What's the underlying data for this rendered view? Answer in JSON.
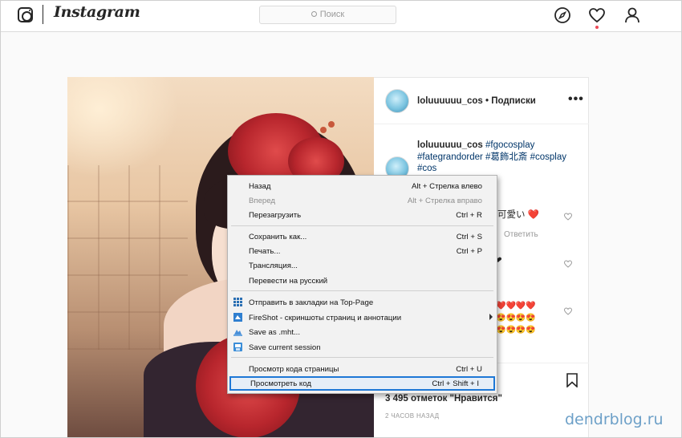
{
  "header": {
    "brand": "Instagram",
    "search_placeholder": "Поиск"
  },
  "post": {
    "username": "loluuuuuu_cos",
    "follow_label": "Подписки",
    "header_line": "loluuuuuu_cos • Подписки",
    "more_label": "•••",
    "caption": {
      "username": "loluuuuuu_cos",
      "tags_line1": "#fgocosplay",
      "tags_line2": "#fategrandorder #葛飾北斎 #cosplay",
      "tags_line3": "#cos"
    },
    "comment_fragments": {
      "c1": "可愛い ❤️",
      "reply": "Ответить",
      "c2": "❤",
      "c3_line1": "❤️❤️❤️❤️",
      "c3_line2": "😍😍😍😍",
      "c3_line3": "😍😍😍😍"
    },
    "likes_text": "3 495 отметок \"Нравится\"",
    "time_text": "2 ЧАСОВ НАЗАД"
  },
  "context_menu": {
    "items": [
      {
        "label": "Назад",
        "shortcut": "Alt + Стрелка влево",
        "disabled": false
      },
      {
        "label": "Вперед",
        "shortcut": "Alt + Стрелка вправо",
        "disabled": true
      },
      {
        "label": "Перезагрузить",
        "shortcut": "Ctrl + R",
        "disabled": false
      },
      {
        "label": "Сохранить как...",
        "shortcut": "Ctrl + S"
      },
      {
        "label": "Печать...",
        "shortcut": "Ctrl + P"
      },
      {
        "label": "Трансляция..."
      },
      {
        "label": "Перевести на русский"
      },
      {
        "label": "Отправить в закладки на Top-Page",
        "icon": "grid-icon"
      },
      {
        "label": "FireShot - скриншоты страниц и аннотации",
        "icon": "fireshot-icon",
        "submenu": true
      },
      {
        "label": "Save as .mht...",
        "icon": "mht-icon"
      },
      {
        "label": "Save current session",
        "icon": "session-icon"
      },
      {
        "label": "Просмотр кода страницы",
        "shortcut": "Ctrl + U"
      },
      {
        "label": "Просмотреть код",
        "shortcut": "Ctrl + Shift + I",
        "highlighted": true
      }
    ]
  },
  "watermark": "dendrblog.ru",
  "colors": {
    "accent_highlight": "#1e78d6",
    "hashtag": "#003569",
    "notification_dot": "#ed4956",
    "watermark": "#6da0c8"
  }
}
